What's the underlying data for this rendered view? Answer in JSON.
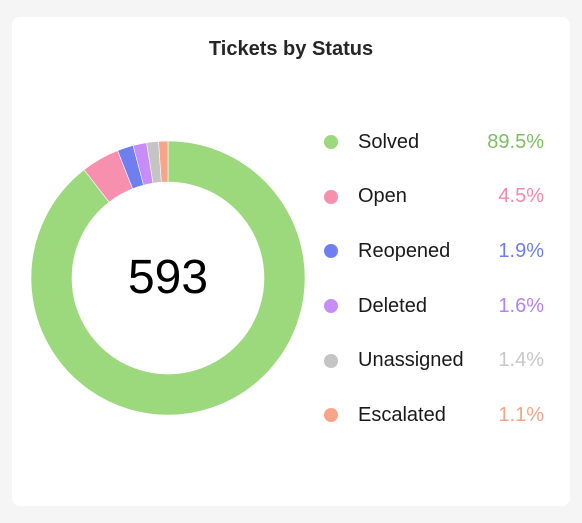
{
  "card": {
    "title": "Tickets by Status"
  },
  "chart_data": {
    "type": "pie",
    "variant": "donut",
    "title": "Tickets by Status",
    "center_label": "593",
    "total": 593,
    "start": "top",
    "direction": "clockwise",
    "legend_position": "right",
    "slices": [
      {
        "label": "Solved",
        "percent": 89.5,
        "percent_text": "89.5%",
        "color": "#9cd87c",
        "text_color": "#7fbf63"
      },
      {
        "label": "Open",
        "percent": 4.5,
        "percent_text": "4.5%",
        "color": "#f78fae",
        "text_color": "#f18aa9"
      },
      {
        "label": "Reopened",
        "percent": 1.9,
        "percent_text": "1.9%",
        "color": "#6f7ff0",
        "text_color": "#6f7fe0"
      },
      {
        "label": "Deleted",
        "percent": 1.6,
        "percent_text": "1.6%",
        "color": "#c78cf7",
        "text_color": "#b483ef"
      },
      {
        "label": "Unassigned",
        "percent": 1.4,
        "percent_text": "1.4%",
        "color": "#c4c4c4",
        "text_color": "#c8c8c8"
      },
      {
        "label": "Escalated",
        "percent": 1.1,
        "percent_text": "1.1%",
        "color": "#f8a48a",
        "text_color": "#f0a58c"
      }
    ]
  }
}
